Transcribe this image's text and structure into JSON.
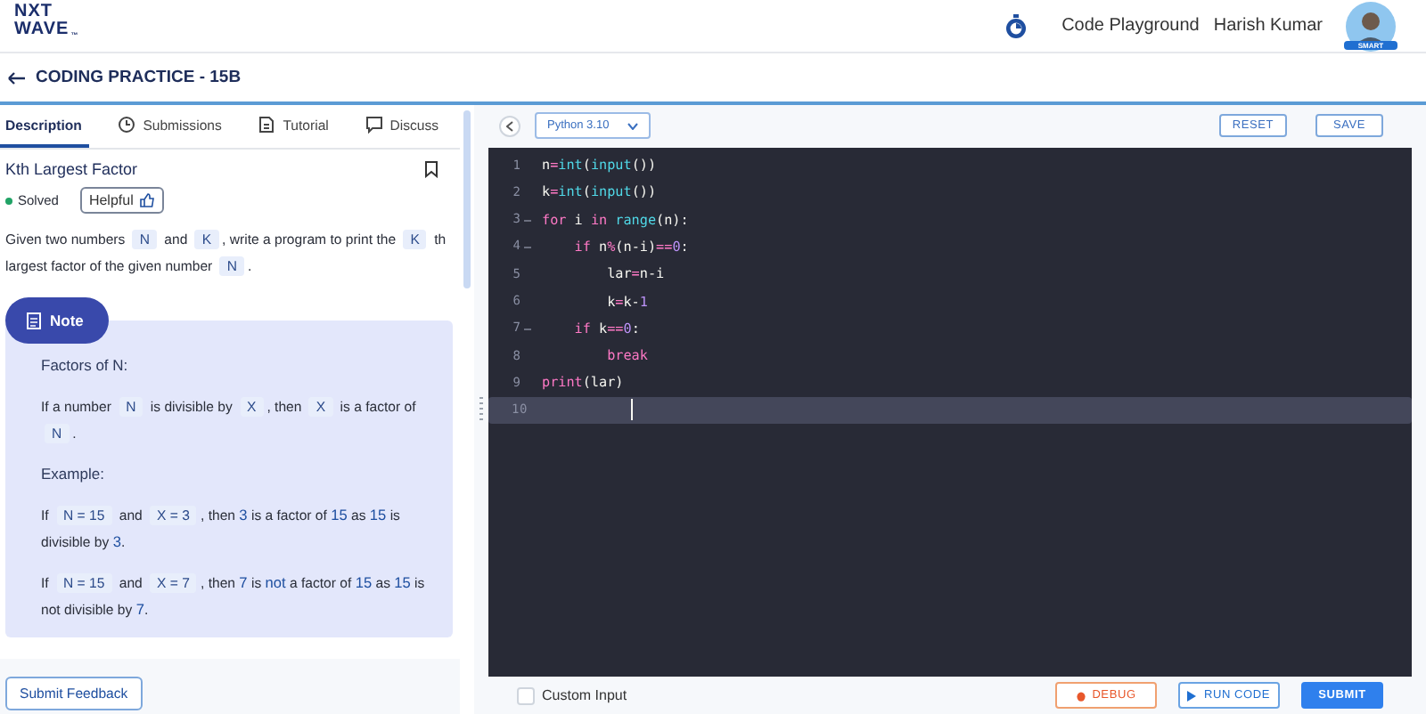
{
  "header": {
    "logo": {
      "line_1": "NXT",
      "line_2": "WAVE",
      "mark": "™"
    },
    "link": "Code Playground",
    "user": {
      "name": "Harish Kumar",
      "badge": "SMART"
    }
  },
  "page_title": "CODING PRACTICE - 15B",
  "tabs": [
    {
      "label": "Description",
      "selected": true
    },
    {
      "label": "Submissions",
      "selected": false
    },
    {
      "label": "Tutorial",
      "selected": false
    },
    {
      "label": "Discuss",
      "selected": false
    }
  ],
  "problem": {
    "title": "Kth Largest Factor",
    "status": "Solved",
    "helpful_button": "Helpful",
    "description": [
      {
        "kind": "text",
        "text": "Given two numbers "
      },
      {
        "kind": "code",
        "text": "N"
      },
      {
        "kind": "text",
        "text": " and "
      },
      {
        "kind": "code",
        "text": "K"
      },
      {
        "kind": "text",
        "text": ", write a program to print the "
      },
      {
        "kind": "code",
        "text": "K"
      },
      {
        "kind": "text",
        "text": " th largest factor of the given number "
      },
      {
        "kind": "code",
        "text": "N"
      },
      {
        "kind": "text",
        "text": "."
      }
    ],
    "note": {
      "label": "Note",
      "heading": "Factors of N:",
      "rule": [
        {
          "kind": "text",
          "text": "If a number "
        },
        {
          "kind": "code",
          "text": "N"
        },
        {
          "kind": "text",
          "text": " is divisible by "
        },
        {
          "kind": "code",
          "text": "X"
        },
        {
          "kind": "text",
          "text": ", then "
        },
        {
          "kind": "code",
          "text": "X"
        },
        {
          "kind": "text",
          "text": " is a factor of "
        },
        {
          "kind": "code",
          "text": "N"
        },
        {
          "kind": "text",
          "text": "."
        }
      ],
      "example_heading": "Example:",
      "examples": [
        [
          {
            "kind": "text",
            "text": "If "
          },
          {
            "kind": "code",
            "text": "N = 15"
          },
          {
            "kind": "text",
            "text": " and "
          },
          {
            "kind": "code",
            "text": "X = 3"
          },
          {
            "kind": "text",
            "text": ", then "
          },
          {
            "kind": "em",
            "text": "3"
          },
          {
            "kind": "text",
            "text": " is a factor of "
          },
          {
            "kind": "em",
            "text": "15"
          },
          {
            "kind": "text",
            "text": " as "
          },
          {
            "kind": "em",
            "text": "15"
          },
          {
            "kind": "text",
            "text": " is divisible by "
          },
          {
            "kind": "em",
            "text": "3"
          },
          {
            "kind": "text",
            "text": "."
          }
        ],
        [
          {
            "kind": "text",
            "text": "If "
          },
          {
            "kind": "code",
            "text": "N = 15"
          },
          {
            "kind": "text",
            "text": " and "
          },
          {
            "kind": "code",
            "text": "X = 7"
          },
          {
            "kind": "text",
            "text": ", then "
          },
          {
            "kind": "em",
            "text": "7"
          },
          {
            "kind": "text",
            "text": " is "
          },
          {
            "kind": "em",
            "text": "not"
          },
          {
            "kind": "text",
            "text": " a factor of "
          },
          {
            "kind": "em",
            "text": "15"
          },
          {
            "kind": "text",
            "text": " as "
          },
          {
            "kind": "em",
            "text": "15"
          },
          {
            "kind": "text",
            "text": " is not divisible by "
          },
          {
            "kind": "em",
            "text": "7"
          },
          {
            "kind": "text",
            "text": "."
          }
        ]
      ]
    },
    "feedback_button": "Submit Feedback"
  },
  "editor": {
    "language": "Python 3.10",
    "toolbar_buttons": [
      "RESET",
      "SAVE"
    ],
    "lines": [
      {
        "number": "1",
        "foldable": false,
        "active": false,
        "tokens": [
          {
            "kind": "id",
            "text": "n"
          },
          {
            "kind": "op",
            "text": "="
          },
          {
            "kind": "fn",
            "text": "int"
          },
          {
            "kind": "id",
            "text": "("
          },
          {
            "kind": "fn",
            "text": "input"
          },
          {
            "kind": "id",
            "text": "())"
          }
        ]
      },
      {
        "number": "2",
        "foldable": false,
        "active": false,
        "tokens": [
          {
            "kind": "id",
            "text": "k"
          },
          {
            "kind": "op",
            "text": "="
          },
          {
            "kind": "fn",
            "text": "int"
          },
          {
            "kind": "id",
            "text": "("
          },
          {
            "kind": "fn",
            "text": "input"
          },
          {
            "kind": "id",
            "text": "())"
          }
        ]
      },
      {
        "number": "3",
        "foldable": true,
        "active": false,
        "tokens": [
          {
            "kind": "kw",
            "text": "for"
          },
          {
            "kind": "id",
            "text": " i "
          },
          {
            "kind": "kw",
            "text": "in"
          },
          {
            "kind": "fn",
            "text": " range"
          },
          {
            "kind": "id",
            "text": "(n):"
          }
        ]
      },
      {
        "number": "4",
        "foldable": true,
        "active": false,
        "tokens": [
          {
            "kind": "kw",
            "text": "    if"
          },
          {
            "kind": "id",
            "text": " n"
          },
          {
            "kind": "op",
            "text": "%"
          },
          {
            "kind": "id",
            "text": "(n-i)"
          },
          {
            "kind": "op",
            "text": "=="
          },
          {
            "kind": "num",
            "text": "0"
          },
          {
            "kind": "id",
            "text": ":"
          }
        ]
      },
      {
        "number": "5",
        "foldable": false,
        "active": false,
        "tokens": [
          {
            "kind": "id",
            "text": "        lar"
          },
          {
            "kind": "op",
            "text": "="
          },
          {
            "kind": "id",
            "text": "n-i"
          }
        ]
      },
      {
        "number": "6",
        "foldable": false,
        "active": false,
        "tokens": [
          {
            "kind": "id",
            "text": "        k"
          },
          {
            "kind": "op",
            "text": "="
          },
          {
            "kind": "id",
            "text": "k-"
          },
          {
            "kind": "num",
            "text": "1"
          }
        ]
      },
      {
        "number": "7",
        "foldable": true,
        "active": false,
        "tokens": [
          {
            "kind": "kw",
            "text": "    if"
          },
          {
            "kind": "id",
            "text": " k"
          },
          {
            "kind": "op",
            "text": "=="
          },
          {
            "kind": "num",
            "text": "0"
          },
          {
            "kind": "id",
            "text": ":"
          }
        ]
      },
      {
        "number": "8",
        "foldable": false,
        "active": false,
        "tokens": [
          {
            "kind": "kw",
            "text": "        break"
          }
        ]
      },
      {
        "number": "9",
        "foldable": false,
        "active": false,
        "tokens": [
          {
            "kind": "kw",
            "text": "print"
          },
          {
            "kind": "id",
            "text": "(lar)"
          }
        ]
      },
      {
        "number": "10",
        "foldable": false,
        "active": true
      }
    ],
    "custom_input": {
      "label": "Custom Input",
      "checked": false
    },
    "actions": [
      {
        "label": "DEBUG",
        "kind": "debug"
      },
      {
        "label": "RUN CODE",
        "kind": "run"
      },
      {
        "label": "SUBMIT",
        "kind": "submit"
      }
    ]
  }
}
